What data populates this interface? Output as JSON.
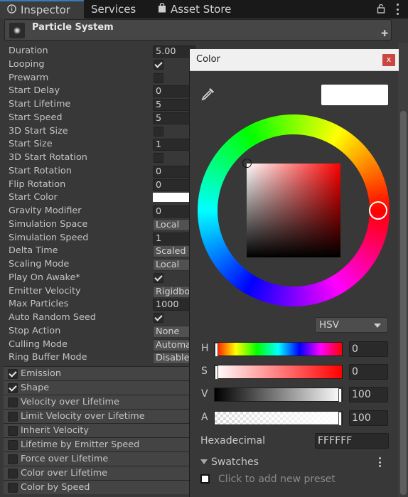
{
  "tabs": [
    {
      "label": "Inspector",
      "icon": "info-icon"
    },
    {
      "label": "Services",
      "icon": "cloud-icon"
    },
    {
      "label": "Asset Store",
      "icon": "shopping-bag-icon"
    }
  ],
  "component": {
    "title": "Particle System",
    "add_symbol": "✚"
  },
  "properties": [
    {
      "label": "Duration",
      "type": "text",
      "value": "5.00"
    },
    {
      "label": "Looping",
      "type": "check",
      "checked": true
    },
    {
      "label": "Prewarm",
      "type": "check",
      "checked": false
    },
    {
      "label": "Start Delay",
      "type": "text",
      "value": "0"
    },
    {
      "label": "Start Lifetime",
      "type": "text",
      "value": "5"
    },
    {
      "label": "Start Speed",
      "type": "text",
      "value": "5"
    },
    {
      "label": "3D Start Size",
      "type": "check",
      "checked": false
    },
    {
      "label": "Start Size",
      "type": "text",
      "value": "1"
    },
    {
      "label": "3D Start Rotation",
      "type": "check",
      "checked": false
    },
    {
      "label": "Start Rotation",
      "type": "text",
      "value": "0"
    },
    {
      "label": "Flip Rotation",
      "type": "text",
      "value": "0"
    },
    {
      "label": "Start Color",
      "type": "color",
      "value": "#ffffff"
    },
    {
      "label": "Gravity Modifier",
      "type": "text",
      "value": "0"
    },
    {
      "label": "Simulation Space",
      "type": "dropdown",
      "value": "Local"
    },
    {
      "label": "Simulation Speed",
      "type": "text",
      "value": "1"
    },
    {
      "label": "Delta Time",
      "type": "dropdown",
      "value": "Scaled"
    },
    {
      "label": "Scaling Mode",
      "type": "dropdown",
      "value": "Local"
    },
    {
      "label": "Play On Awake*",
      "type": "check",
      "checked": true
    },
    {
      "label": "Emitter Velocity",
      "type": "dropdown",
      "value": "Rigidbody"
    },
    {
      "label": "Max Particles",
      "type": "text",
      "value": "1000"
    },
    {
      "label": "Auto Random Seed",
      "type": "check",
      "checked": true
    },
    {
      "label": "Stop Action",
      "type": "dropdown",
      "value": "None"
    },
    {
      "label": "Culling Mode",
      "type": "dropdown",
      "value": "Automatic"
    },
    {
      "label": "Ring Buffer Mode",
      "type": "dropdown",
      "value": "Disabled"
    }
  ],
  "modules": [
    {
      "label": "Emission",
      "checked": true
    },
    {
      "label": "Shape",
      "checked": true
    },
    {
      "label": "Velocity over Lifetime",
      "checked": false
    },
    {
      "label": "Limit Velocity over Lifetime",
      "checked": false
    },
    {
      "label": "Inherit Velocity",
      "checked": false
    },
    {
      "label": "Lifetime by Emitter Speed",
      "checked": false
    },
    {
      "label": "Force over Lifetime",
      "checked": false
    },
    {
      "label": "Color over Lifetime",
      "checked": false
    },
    {
      "label": "Color by Speed",
      "checked": false
    }
  ],
  "color_picker": {
    "title": "Color",
    "close_label": "x",
    "current_color": "#ffffff",
    "mode": "HSV",
    "sliders": [
      {
        "label": "H",
        "value": "0",
        "level": 0.0
      },
      {
        "label": "S",
        "value": "0",
        "level": 0.0
      },
      {
        "label": "V",
        "value": "100",
        "level": 1.0
      },
      {
        "label": "A",
        "value": "100",
        "level": 1.0
      }
    ],
    "hex_label": "Hexadecimal",
    "hex_value": "FFFFFF",
    "swatches_label": "Swatches",
    "add_preset_label": "Click to add new preset"
  }
}
